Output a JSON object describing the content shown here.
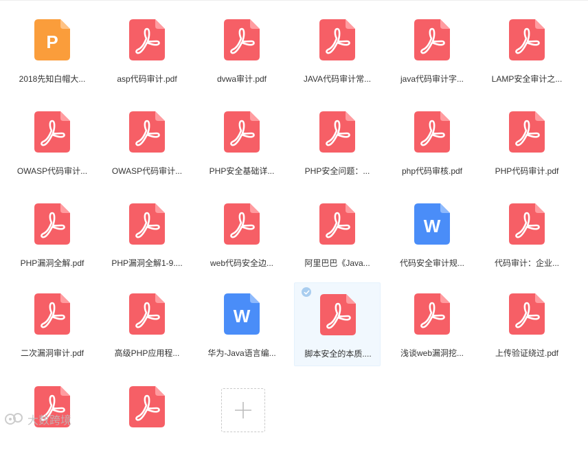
{
  "files": [
    {
      "name": "2018先知白帽大...",
      "type": "ppt"
    },
    {
      "name": "asp代码审计.pdf",
      "type": "pdf"
    },
    {
      "name": "dvwa审计.pdf",
      "type": "pdf"
    },
    {
      "name": "JAVA代码审计常...",
      "type": "pdf"
    },
    {
      "name": "java代码审计字...",
      "type": "pdf"
    },
    {
      "name": "LAMP安全审计之...",
      "type": "pdf"
    },
    {
      "name": "OWASP代码审计...",
      "type": "pdf"
    },
    {
      "name": "OWASP代码审计...",
      "type": "pdf"
    },
    {
      "name": "PHP安全基础详...",
      "type": "pdf"
    },
    {
      "name": "PHP安全问题：...",
      "type": "pdf"
    },
    {
      "name": "php代码审核.pdf",
      "type": "pdf"
    },
    {
      "name": "PHP代码审计.pdf",
      "type": "pdf"
    },
    {
      "name": "PHP漏洞全解.pdf",
      "type": "pdf"
    },
    {
      "name": "PHP漏洞全解1-9....",
      "type": "pdf"
    },
    {
      "name": "web代码安全边...",
      "type": "pdf"
    },
    {
      "name": "阿里巴巴《Java...",
      "type": "pdf"
    },
    {
      "name": "代码安全审计规...",
      "type": "word"
    },
    {
      "name": "代码审计：企业...",
      "type": "pdf"
    },
    {
      "name": "二次漏洞审计.pdf",
      "type": "pdf"
    },
    {
      "name": "高级PHP应用程...",
      "type": "pdf"
    },
    {
      "name": "华为-Java语言编...",
      "type": "word"
    },
    {
      "name": "脚本安全的本质....",
      "type": "pdf",
      "selected": true
    },
    {
      "name": "浅谈web漏洞挖...",
      "type": "pdf"
    },
    {
      "name": "上传验证绕过.pdf",
      "type": "pdf"
    },
    {
      "name": "",
      "type": "pdf"
    },
    {
      "name": "",
      "type": "pdf"
    }
  ],
  "icons": {
    "pdf": {
      "name": "pdf-file-icon",
      "color": "#f65f66",
      "fold": "#ff9ca0"
    },
    "ppt": {
      "name": "ppt-file-icon",
      "color": "#fa9d3b",
      "fold": "#ffc283",
      "letter": "P"
    },
    "word": {
      "name": "word-file-icon",
      "color": "#4a8df8",
      "fold": "#8fbafc",
      "letter": "W"
    }
  },
  "watermark": {
    "text": "大数跨境"
  }
}
